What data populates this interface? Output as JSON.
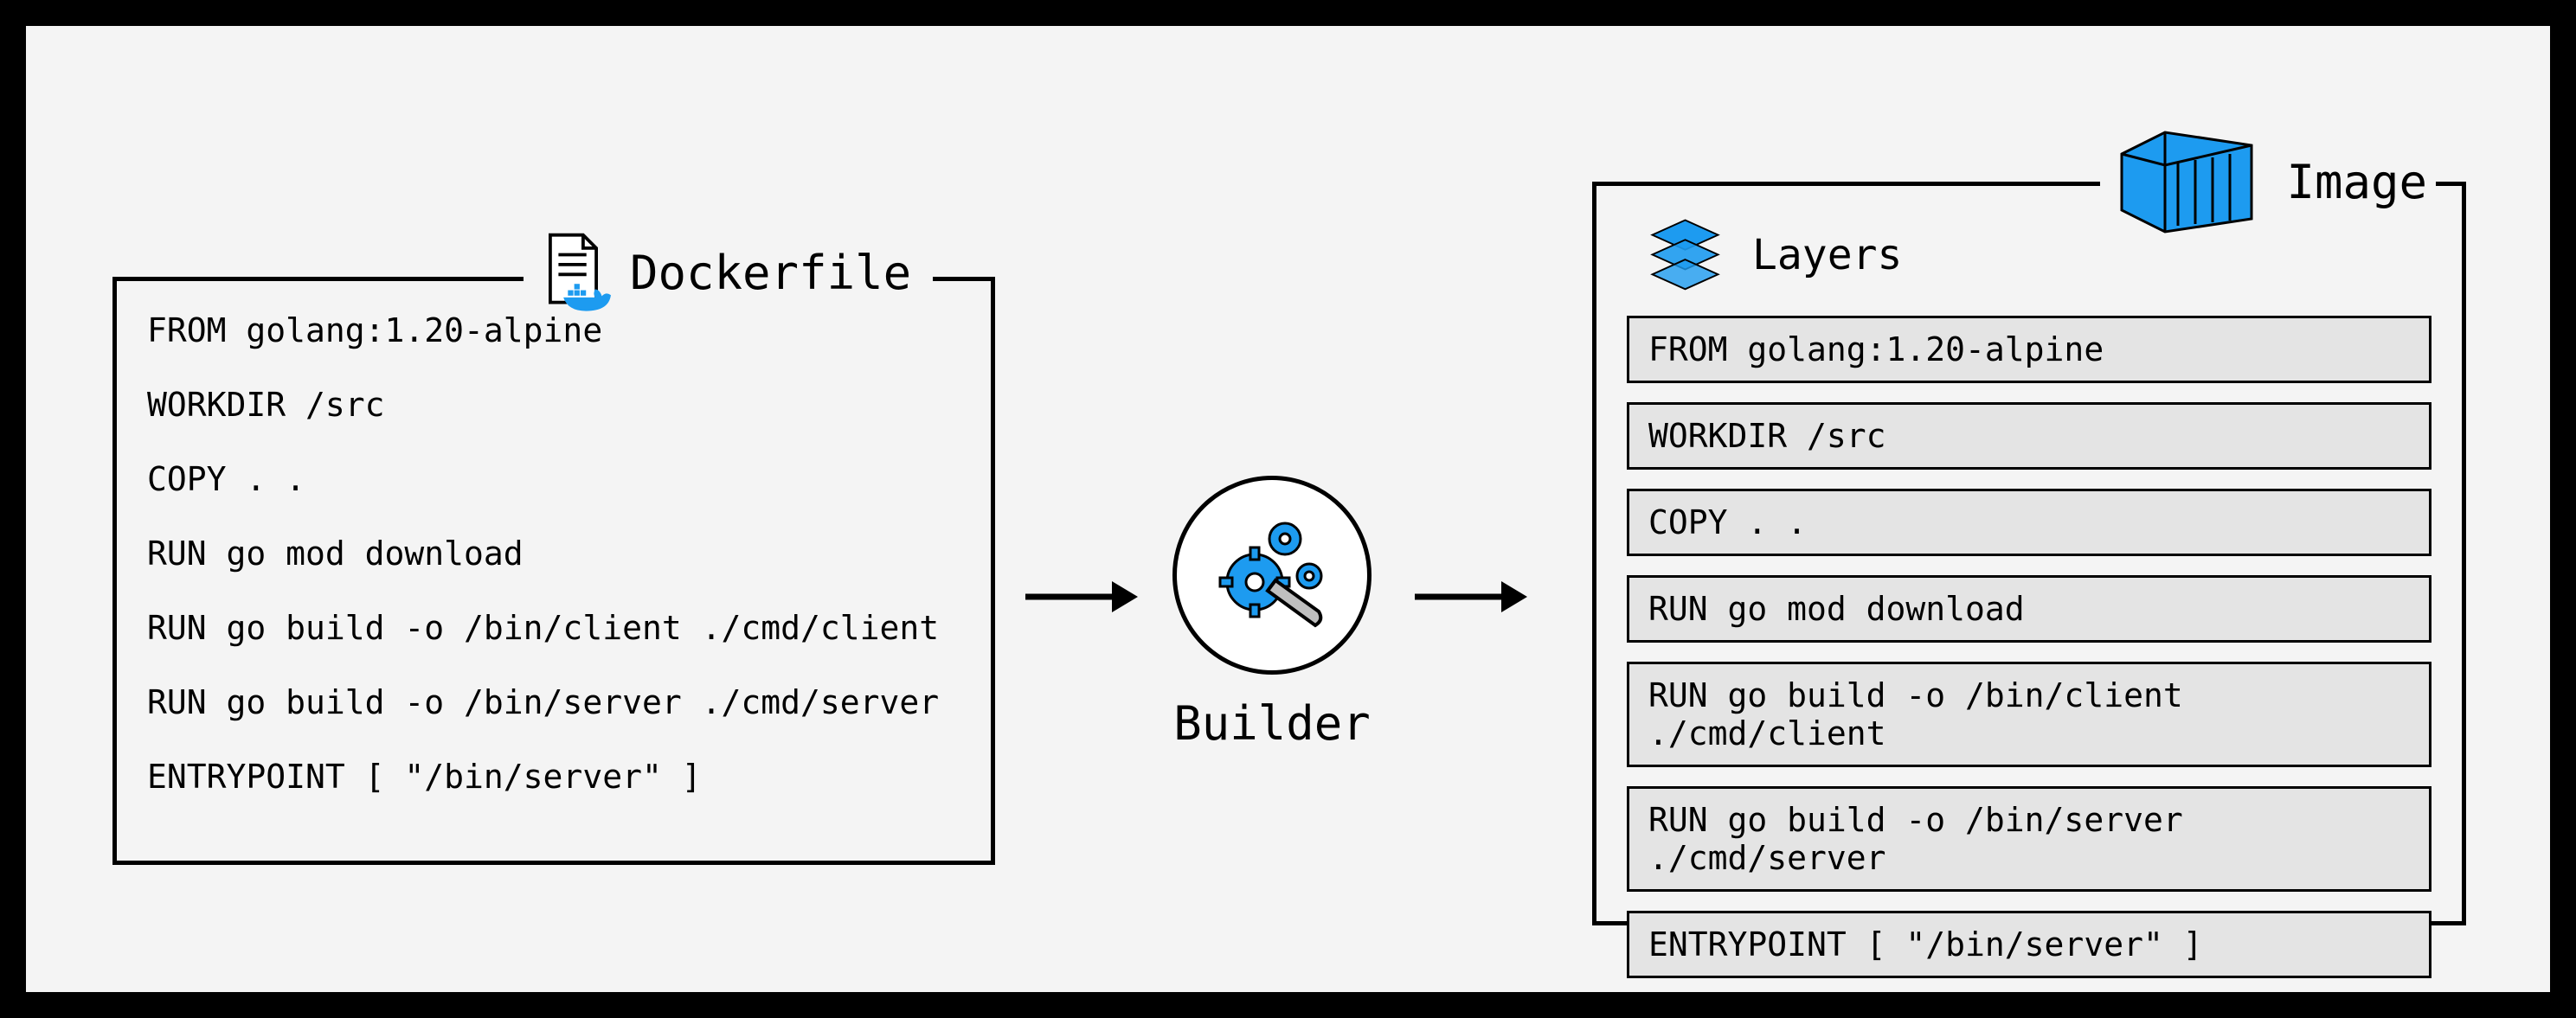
{
  "dockerfile": {
    "title": "Dockerfile",
    "lines": [
      "FROM golang:1.20-alpine",
      "WORKDIR /src",
      "COPY . .",
      "RUN go mod download",
      "RUN go build -o /bin/client ./cmd/client",
      "RUN go build -o /bin/server ./cmd/server",
      "ENTRYPOINT [ \"/bin/server\" ]"
    ]
  },
  "builder": {
    "label": "Builder"
  },
  "image": {
    "title": "Image",
    "layers_label": "Layers",
    "layers": [
      "FROM golang:1.20-alpine",
      "WORKDIR /src",
      "COPY . .",
      "RUN go mod download",
      "RUN go build -o /bin/client ./cmd/client",
      "RUN go build -o /bin/server ./cmd/server",
      "ENTRYPOINT [ \"/bin/server\" ]"
    ]
  }
}
